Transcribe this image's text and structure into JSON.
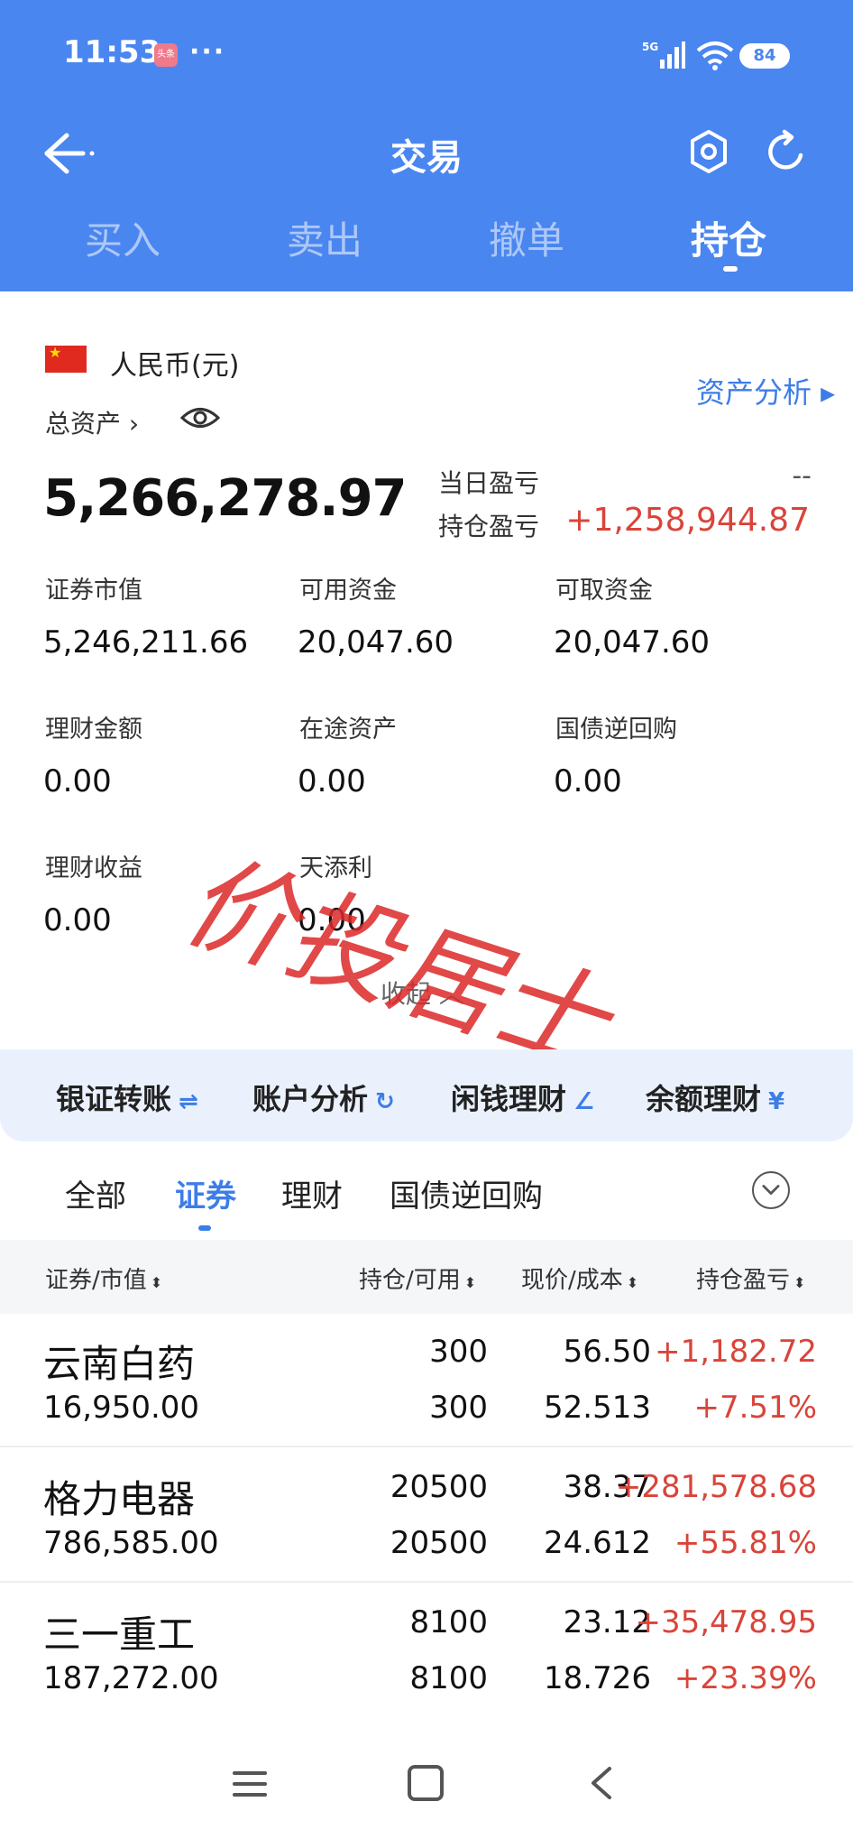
{
  "status_bar": {
    "time": "11:53",
    "badge": "头条",
    "dots": "···",
    "network": "5G",
    "battery": "84"
  },
  "nav": {
    "title": "交易"
  },
  "tabs": [
    "买入",
    "卖出",
    "撤单",
    "持仓"
  ],
  "account": {
    "currency": "人民币(元)",
    "analysis_link": "资产分析 ▸",
    "total_assets_label": "总资产 ›",
    "total_assets": "5,266,278.97",
    "day_pl_label": "当日盈亏",
    "day_pl": "--",
    "hold_pl_label": "持仓盈亏",
    "hold_pl": "+1,258,944.87",
    "fields": [
      {
        "label": "证券市值",
        "value": "5,246,211.66"
      },
      {
        "label": "可用资金",
        "value": "20,047.60"
      },
      {
        "label": "可取资金",
        "value": "20,047.60"
      },
      {
        "label": "理财金额",
        "value": "0.00"
      },
      {
        "label": "在途资产",
        "value": "0.00"
      },
      {
        "label": "国债逆回购",
        "value": "0.00"
      },
      {
        "label": "理财收益",
        "value": "0.00"
      },
      {
        "label": "天添利",
        "value": "0.00"
      }
    ],
    "collapse": "收起 ︿",
    "watermark": "价投居士"
  },
  "quick_actions": [
    {
      "label": "银证转账",
      "icon": "⇌"
    },
    {
      "label": "账户分析",
      "icon": "↻"
    },
    {
      "label": "闲钱理财",
      "icon": "∠"
    },
    {
      "label": "余额理财",
      "icon": "¥"
    }
  ],
  "filter_tabs": [
    "全部",
    "证券",
    "理财",
    "国债逆回购"
  ],
  "table": {
    "headers": [
      "证券/市值",
      "持仓/可用",
      "现价/成本",
      "持仓盈亏"
    ],
    "rows": [
      {
        "name": "云南白药",
        "market_value": "16,950.00",
        "position": "300",
        "available": "300",
        "price": "56.50",
        "cost": "52.513",
        "pl": "+1,182.72",
        "pl_pct": "+7.51%"
      },
      {
        "name": "格力电器",
        "market_value": "786,585.00",
        "position": "20500",
        "available": "20500",
        "price": "38.37",
        "cost": "24.612",
        "pl": "+281,578.68",
        "pl_pct": "+55.81%"
      },
      {
        "name": "三一重工",
        "market_value": "187,272.00",
        "position": "8100",
        "available": "8100",
        "price": "23.12",
        "cost": "18.726",
        "pl": "+35,478.95",
        "pl_pct": "+23.39%"
      }
    ]
  }
}
